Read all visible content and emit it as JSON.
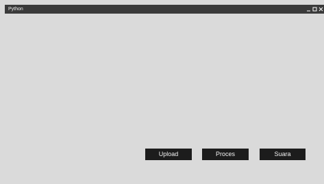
{
  "window": {
    "title": "Python"
  },
  "title_controls": {
    "minimize": "–",
    "maximize": "□",
    "close": "✕"
  },
  "buttons": {
    "upload_label": "Upload",
    "proces_label": "Proces",
    "suara_label": "Suara"
  },
  "colors": {
    "titlebar": "#3a3a3a",
    "window_background": "#dadada",
    "button_background": "#1c1c1c",
    "button_text": "#f2f2f2"
  }
}
